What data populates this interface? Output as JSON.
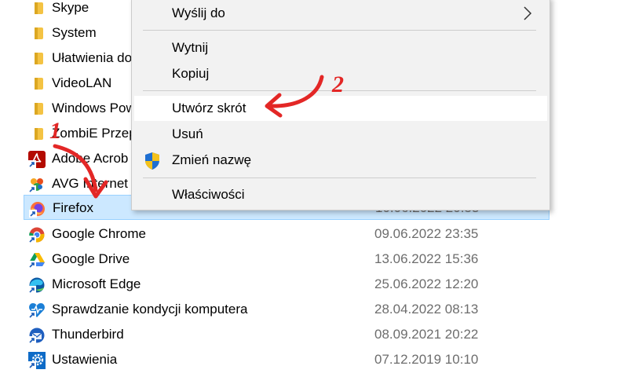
{
  "file_list": {
    "rows": [
      {
        "name": "Skype",
        "icon": "folder-icon",
        "date": ""
      },
      {
        "name": "System",
        "icon": "folder-icon",
        "date": ""
      },
      {
        "name": "Ułatwienia do",
        "icon": "folder-icon",
        "date": ""
      },
      {
        "name": "VideoLAN",
        "icon": "folder-icon",
        "date": ""
      },
      {
        "name": "Windows Pow",
        "icon": "folder-icon",
        "date": ""
      },
      {
        "name": "ZombiE Przep",
        "icon": "folder-icon",
        "date": ""
      },
      {
        "name": "Adobe Acrob",
        "icon": "adobe-acrobat-shortcut-icon",
        "date": ""
      },
      {
        "name": "AVG Internet",
        "icon": "avg-shortcut-icon",
        "date": ""
      },
      {
        "name": "Firefox",
        "icon": "firefox-shortcut-icon",
        "date": "10.06.2022 20:53",
        "selected": true
      },
      {
        "name": "Google Chrome",
        "icon": "chrome-shortcut-icon",
        "date": "09.06.2022 23:35"
      },
      {
        "name": "Google Drive",
        "icon": "google-drive-shortcut-icon",
        "date": "13.06.2022 15:36"
      },
      {
        "name": "Microsoft Edge",
        "icon": "edge-shortcut-icon",
        "date": "25.06.2022 12:20"
      },
      {
        "name": "Sprawdzanie kondycji komputera",
        "icon": "pc-health-shortcut-icon",
        "date": "28.04.2022 08:13"
      },
      {
        "name": "Thunderbird",
        "icon": "thunderbird-shortcut-icon",
        "date": "08.09.2021 20:22"
      },
      {
        "name": "Ustawienia",
        "icon": "settings-shortcut-icon",
        "date": "07.12.2019 10:10"
      }
    ]
  },
  "context_menu": {
    "items": {
      "send_to": "Wyślij do",
      "cut": "Wytnij",
      "copy": "Kopiuj",
      "create_shortcut": "Utwórz skrót",
      "delete": "Usuń",
      "rename": "Zmień nazwę",
      "properties": "Właściwości"
    },
    "hovered": "create_shortcut",
    "submenu_icon": "chevron-right-icon",
    "rename_icon": "uac-shield-icon"
  },
  "annotations": {
    "step1": "1",
    "step2": "2",
    "color": "#e32726"
  },
  "colors": {
    "selection_bg": "#cce8ff",
    "selection_border": "#99d1ff",
    "menu_bg": "#f2f2f2",
    "date_text": "#6d6d6d"
  }
}
